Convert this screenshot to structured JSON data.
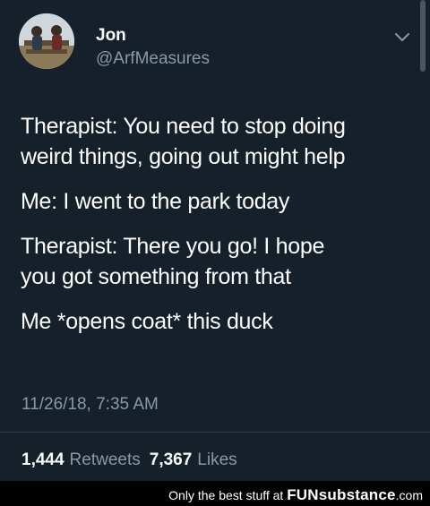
{
  "user": {
    "name": "Jon",
    "handle": "@ArfMeasures"
  },
  "tweet": {
    "paragraphs": [
      [
        "Therapist: You need to stop doing",
        "weird things, going out might help"
      ],
      [
        "Me: I went to the park today"
      ],
      [
        "Therapist: There you go! I hope",
        "you got something from that"
      ],
      [
        "Me *opens coat* this duck"
      ]
    ],
    "timestamp": "11/26/18, 7:35 AM"
  },
  "stats": {
    "retweets_count": "1,444",
    "retweets_label": "Retweets",
    "likes_count": "7,367",
    "likes_label": "Likes"
  },
  "footer": {
    "text": "Only the best stuff at",
    "brand": "FUNsubstance",
    "brand_suffix": ".com"
  },
  "colors": {
    "background": "#15202b",
    "secondary_text": "#8899a6",
    "footer_bg": "#000000"
  },
  "icons": {
    "menu": "chevron-down-icon"
  }
}
